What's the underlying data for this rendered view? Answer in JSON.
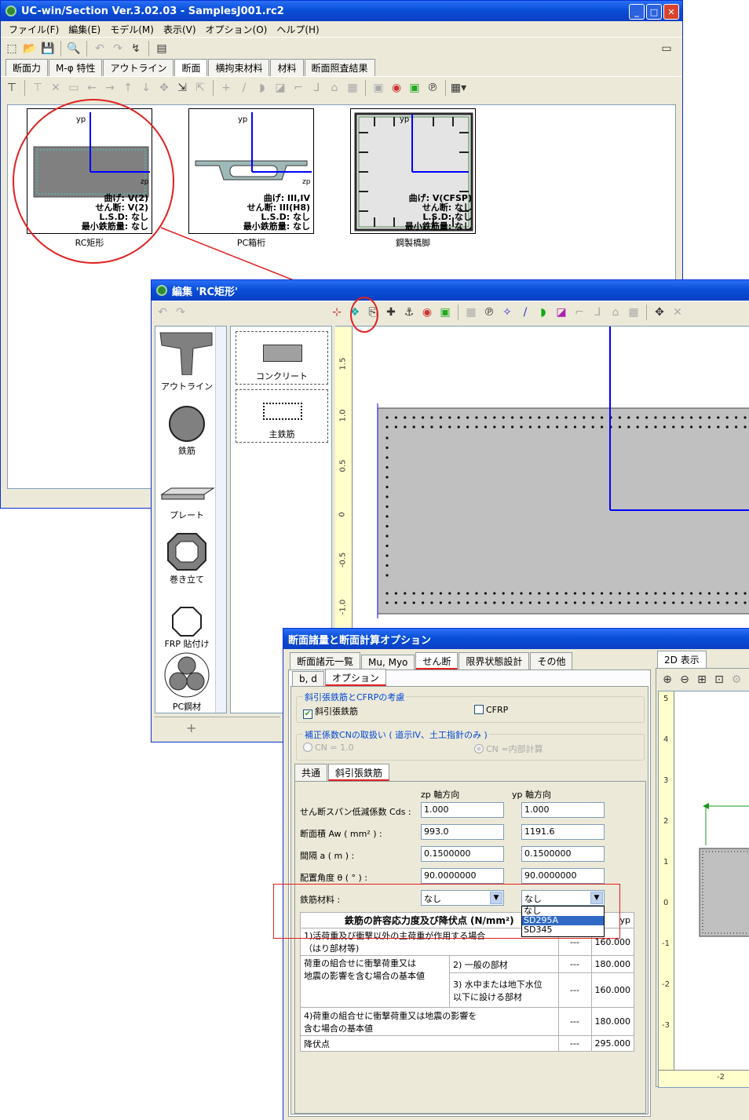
{
  "main": {
    "title": "UC-win/Section Ver.3.02.03 - SamplesJ001.rc2",
    "menu": [
      "ファイル(F)",
      "編集(E)",
      "モデル(M)",
      "表示(V)",
      "オプション(O)",
      "ヘルプ(H)"
    ],
    "tabs": [
      "断面力",
      "M-φ 特性",
      "アウトライン",
      "断面",
      "横拘束材料",
      "材料",
      "断面照査結果"
    ],
    "active_tab": "断面",
    "thumbs": [
      {
        "label": "RC矩形",
        "text": [
          "曲げ: V(2)",
          "せん断: V(2)",
          "L.S.D: なし",
          "最小鉄筋量: なし"
        ]
      },
      {
        "label": "PC箱桁",
        "text": [
          "曲げ: III,IV",
          "せん断: III(H8)",
          "L.S.D: なし",
          "最小鉄筋量: なし"
        ]
      },
      {
        "label": "鋼製橋脚",
        "text": [
          "曲げ: V(CFSP)",
          "せん断: なし",
          "L.S.D: なし",
          "最小鉄筋量: なし"
        ]
      }
    ],
    "axis_yp": "yp",
    "axis_zp": "zp"
  },
  "edit": {
    "title": "編集 'RC矩形'",
    "palette": [
      "アウトライン",
      "鉄筋",
      "プレート",
      "巻き立て",
      "FRP 貼付け",
      "PC鋼材"
    ],
    "parts": [
      "コンクリート",
      "主鉄筋"
    ],
    "ruler": [
      "1.5",
      "1.0",
      "0.5",
      "0",
      "-0.5",
      "-1.0"
    ]
  },
  "dialog": {
    "title": "断面諸量と断面計算オプション",
    "tabs": [
      "断面諸元一覧",
      "Mu, Myo",
      "せん断",
      "限界状態設計",
      "その他"
    ],
    "active_tab": "せん断",
    "subtabs": [
      "b, d",
      "オプション"
    ],
    "active_subtab": "オプション",
    "group1_title": "斜引張鉄筋とCFRPの考慮",
    "chk_rebar": "斜引張鉄筋",
    "chk_cfrp": "CFRP",
    "group2_title": "補正係数CNの取扱い ( 道示IV、土工指針のみ )",
    "radio1": "CN = 1.0",
    "radio2": "CN =内部計算",
    "subtabs2": [
      "共通",
      "斜引張鉄筋"
    ],
    "col_zp": "zp 軸方向",
    "col_yp": "yp 軸方向",
    "rows": [
      {
        "label": "せん断スパン低減係数  Cds :",
        "zp": "1.000",
        "yp": "1.000"
      },
      {
        "label": "断面積  Aw ( mm² ) :",
        "zp": "993.0",
        "yp": "1191.6"
      },
      {
        "label": "間隔  a ( m ) :",
        "zp": "0.1500000",
        "yp": "0.1500000"
      },
      {
        "label": "配置角度  θ ( ° ) :",
        "zp": "90.0000000",
        "yp": "90.0000000"
      }
    ],
    "material_label": "鉄筋材料 :",
    "material_zp": "なし",
    "material_yp": "なし",
    "dropdown_options": [
      "なし",
      "SD295A",
      "SD345"
    ],
    "dropdown_selected": "SD295A",
    "stress_header": "鉄筋の許容応力度及び降伏点  (N/mm²)",
    "stress_col": "yp",
    "stress_rows": [
      {
        "label": "1)活荷重及び衝撃以外の主荷重が作用する場合\n（はり部材等)",
        "dash": "---",
        "val": "160.000"
      },
      {
        "label": "荷重の組合せに衝撃荷重又は\n地震の影響を含む場合の基本値",
        "sub": "2) 一般の部材",
        "dash": "---",
        "val": "180.000"
      },
      {
        "label": "",
        "sub": "3) 水中または地下水位\n以下に設ける部材",
        "dash": "---",
        "val": "160.000"
      },
      {
        "label": "4)荷重の組合せに衝撃荷重又は地震の影響を\n含む場合の基本値",
        "dash": "---",
        "val": "180.000"
      },
      {
        "label": "降伏点",
        "dash": "---",
        "val": "295.000"
      }
    ],
    "view_tab": "2D 表示",
    "view_ruler": [
      "5",
      "4",
      "3",
      "2",
      "1",
      "0",
      "-1",
      "-2",
      "-3"
    ],
    "view_xlabel": "-2"
  }
}
